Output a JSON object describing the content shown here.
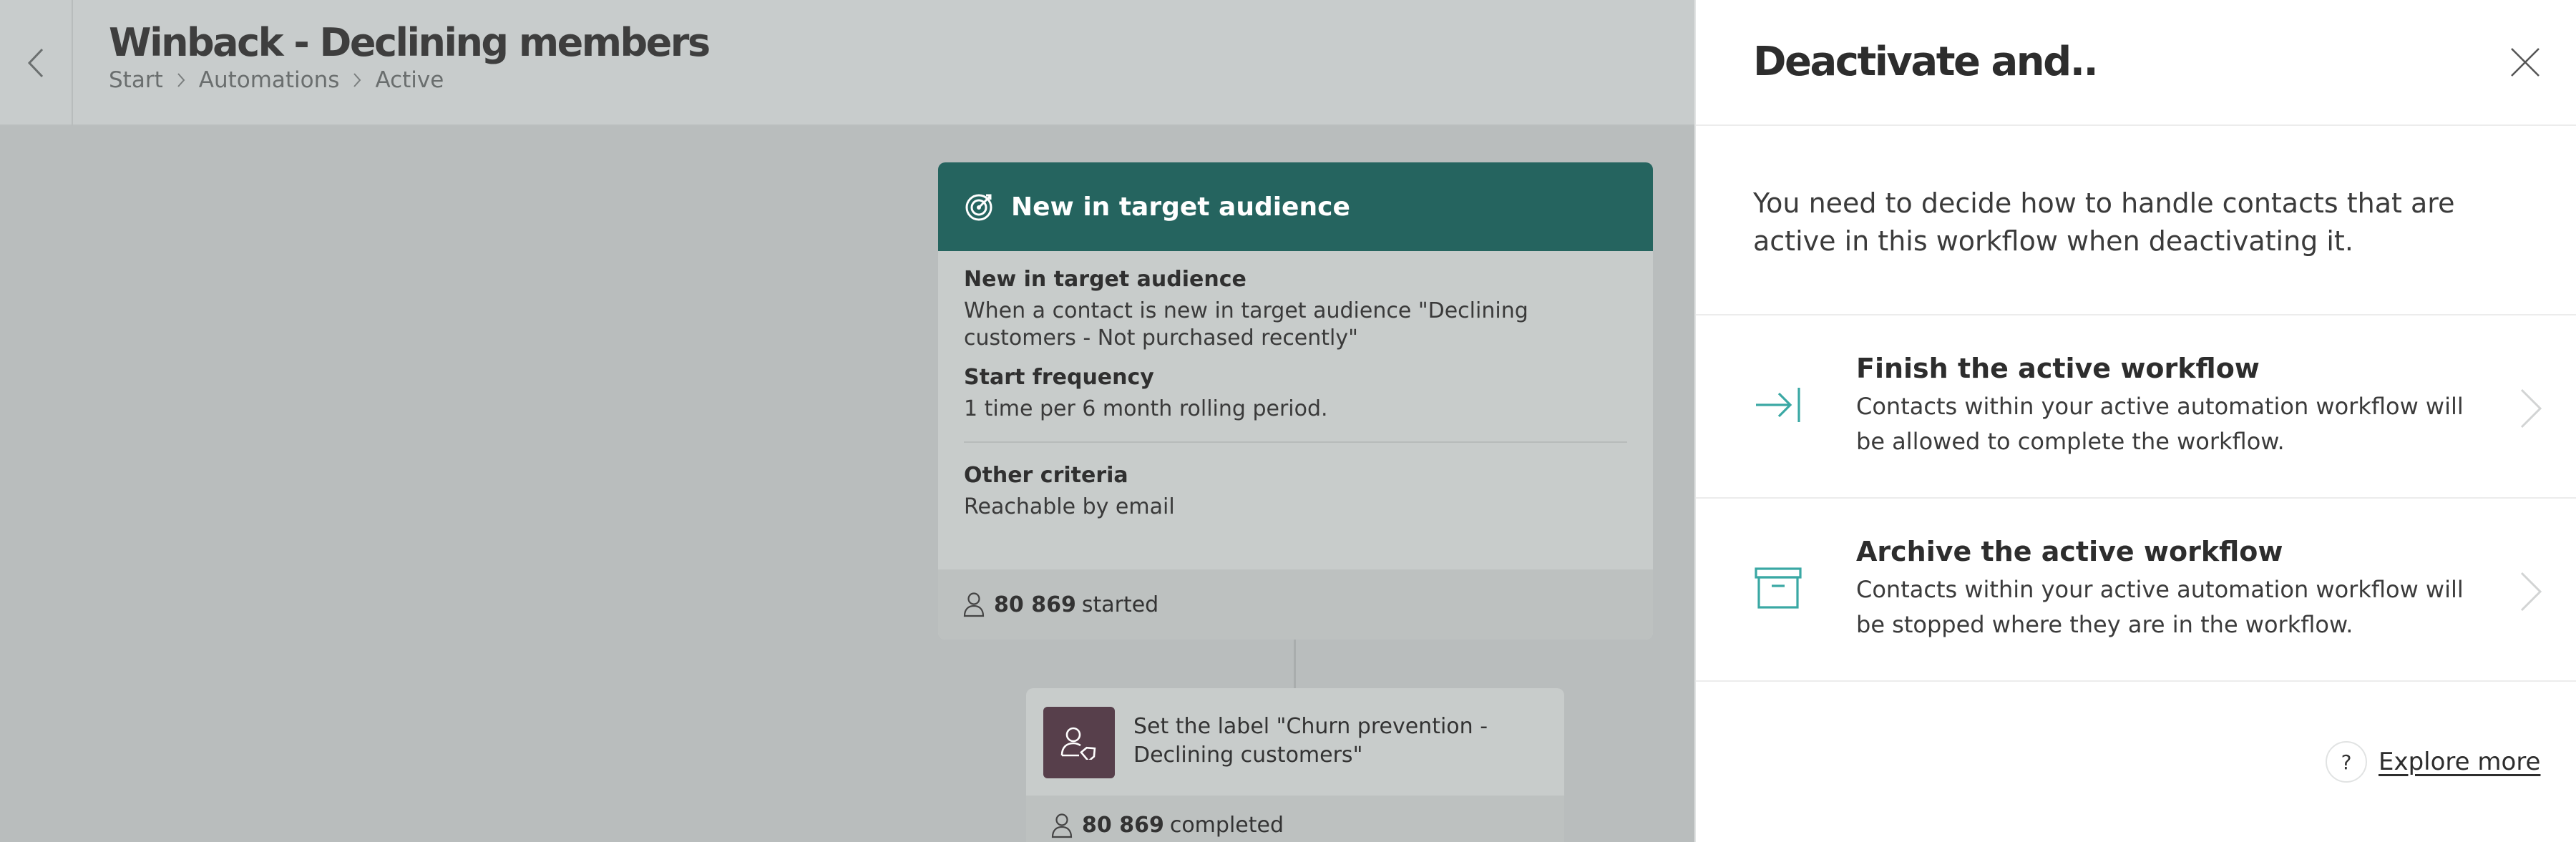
{
  "header": {
    "title": "Winback - Declining members",
    "breadcrumb": [
      "Start",
      "Automations",
      "Active"
    ]
  },
  "trigger": {
    "title": "New in target audience",
    "section1_label": "New in target audience",
    "section1_text": "When a contact is new in target audience \"Declining customers - Not purchased recently\"",
    "section2_label": "Start frequency",
    "section2_text": "1 time per 6 month rolling period.",
    "section3_label": "Other criteria",
    "section3_text": "Reachable by email",
    "count": "80 869",
    "count_label": "started"
  },
  "action": {
    "text": "Set the label \"Churn prevention - Declining customers\"",
    "count": "80 869",
    "count_label": "completed"
  },
  "panel": {
    "title": "Deactivate and..",
    "description": "You need to decide how to handle contacts that are active in this workflow when deactivating it.",
    "options": [
      {
        "title": "Finish the active workflow",
        "description": "Contacts within your active automation workflow will be allowed to complete the workflow.",
        "icon": "arrow-to-line-icon"
      },
      {
        "title": "Archive the active workflow",
        "description": "Contacts within your active automation workflow will be stopped where they are in the workflow.",
        "icon": "archive-box-icon"
      }
    ],
    "help_symbol": "?",
    "explore_label": "Explore more"
  },
  "colors": {
    "trigger_header": "#25645f",
    "action_icon_bg": "#573f4b",
    "accent_teal": "#3aa8a4",
    "overlay": "#b9bdbd",
    "panel_bg": "#ffffff"
  }
}
